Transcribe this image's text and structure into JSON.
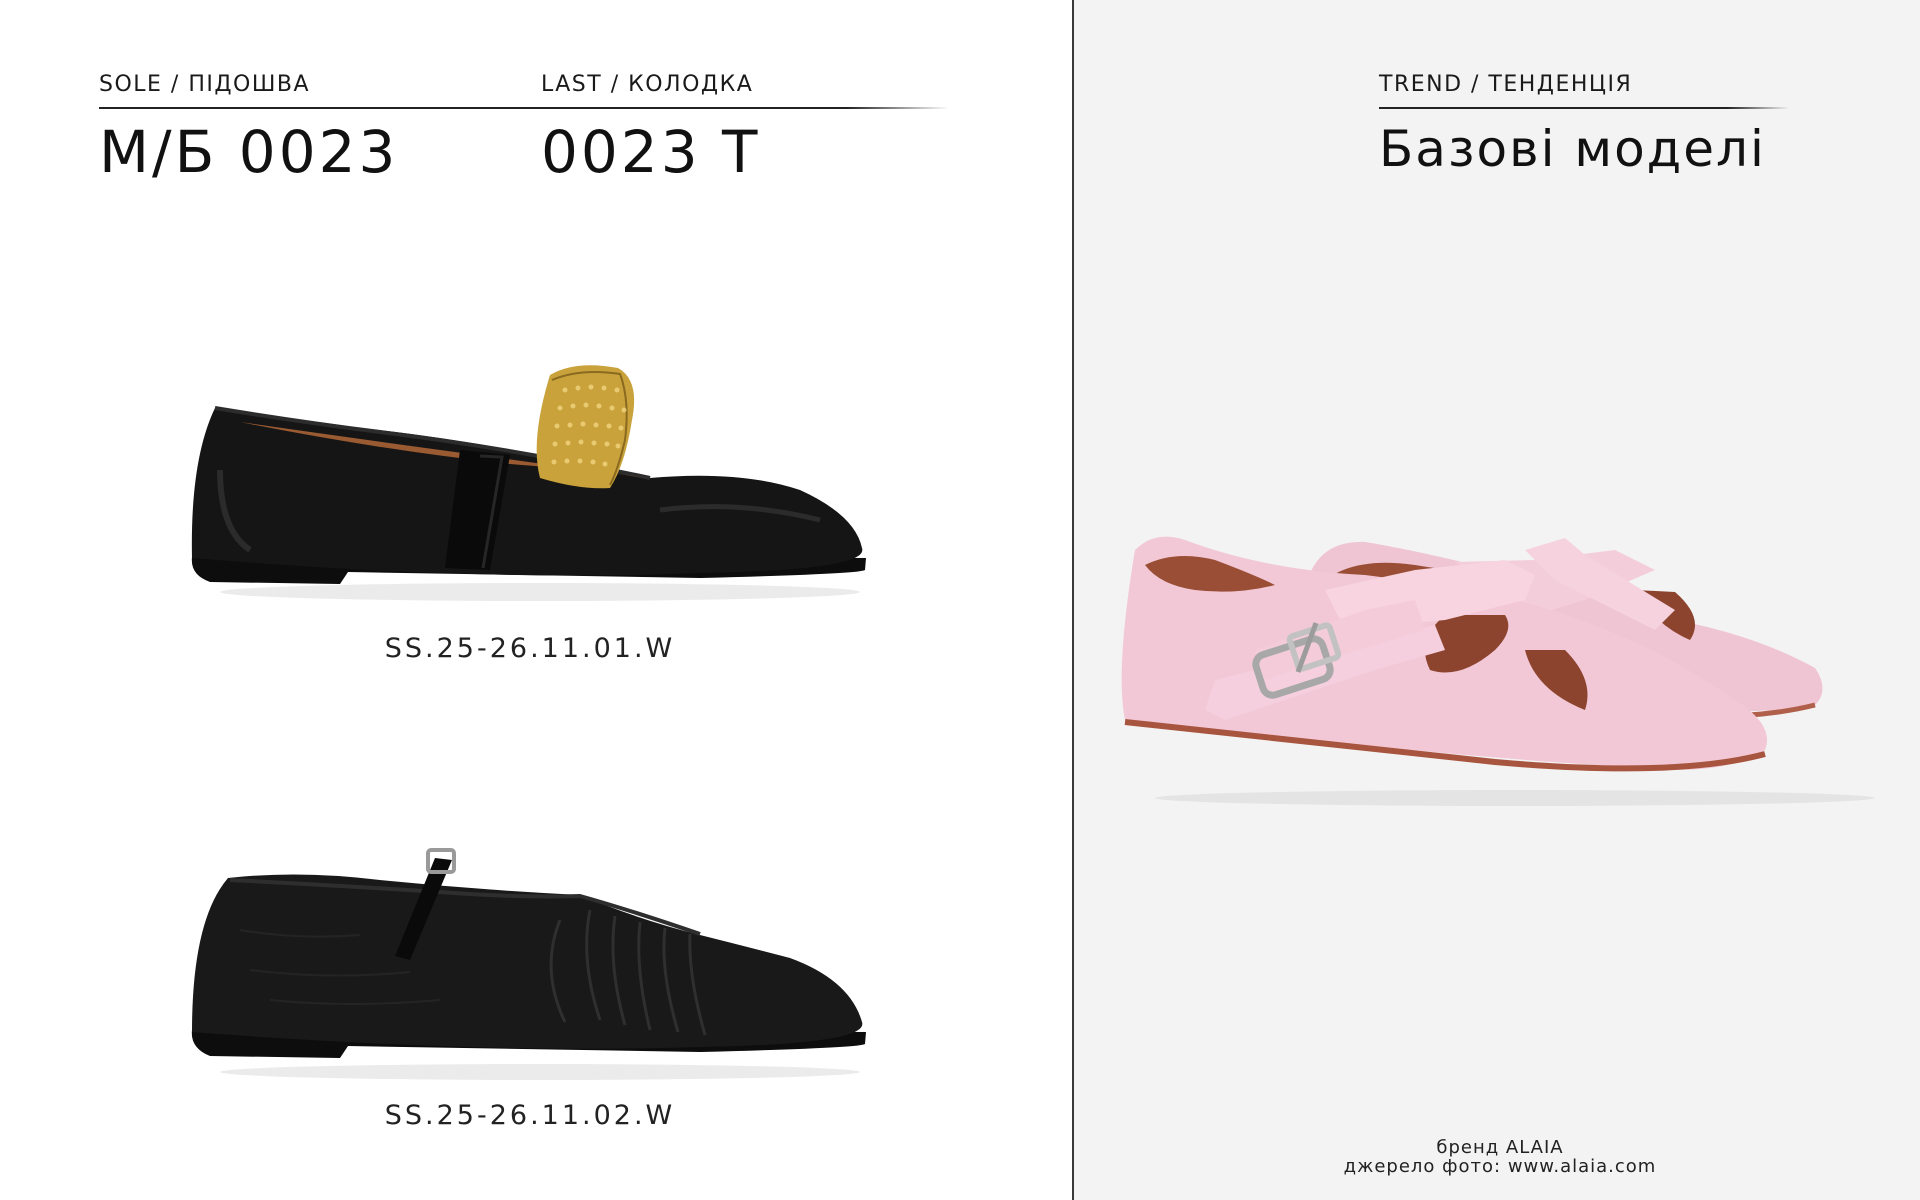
{
  "header": {
    "sole_caption": "SOLE / ПІДОШВА",
    "sole_value": "М/Б 0023",
    "last_caption": "LAST / КОЛОДКА",
    "last_value": "0023 Т",
    "trend_caption": "TREND / ТЕНДЕНЦІЯ",
    "trend_value": "Базові моделі"
  },
  "products": [
    {
      "code": "SS.25-26.11.01.W",
      "image": "black-ballet-flat-gold-studded-strap"
    },
    {
      "code": "SS.25-26.11.02.W",
      "image": "black-ruched-leather-ballet-flat"
    }
  ],
  "trend_image": "pink-leather-crossover-buckle-flats",
  "credit": {
    "brand": "бренд ALAIA",
    "source": "джерело фото: www.alaia.com"
  },
  "colors": {
    "panel_left": "#ffffff",
    "panel_right": "#f3f3f3",
    "divider": "#3a3a3a",
    "shoe_black": "#151515",
    "gold": "#c9a23c",
    "pink": "#f2c8d6",
    "lining": "#9a4e36"
  }
}
